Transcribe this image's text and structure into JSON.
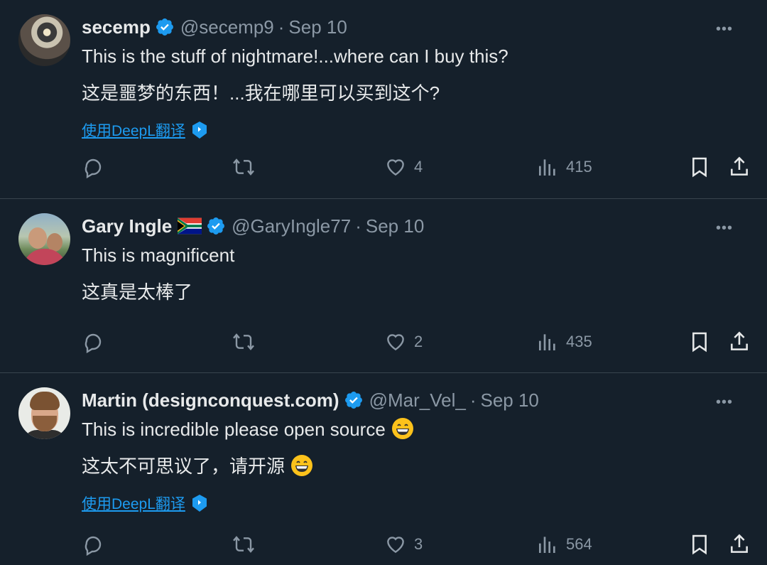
{
  "tweets": [
    {
      "author": "secemp",
      "handle": "@secemp9",
      "dot": "·",
      "date": "Sep 10",
      "text_en": "This is the stuff of nightmare!...where can I buy this?",
      "text_zh": "这是噩梦的东西！...我在哪里可以买到这个?",
      "translate_label": "使用DeepL翻译",
      "replies": "",
      "retweets": "",
      "likes": "4",
      "views": "415"
    },
    {
      "author": "Gary Ingle",
      "handle": "@GaryIngle77",
      "dot": "·",
      "date": "Sep 10",
      "text_en": "This is magnificent",
      "text_zh": "这真是太棒了",
      "replies": "",
      "retweets": "",
      "likes": "2",
      "views": "435"
    },
    {
      "author": "Martin (designconquest.com)",
      "handle": "@Mar_Vel_",
      "dot": "·",
      "date": "Sep 10",
      "text_en": "This is incredible please open source",
      "text_zh": "这太不可思议了，请开源",
      "translate_label": "使用DeepL翻译",
      "replies": "",
      "retweets": "",
      "likes": "3",
      "views": "564"
    }
  ],
  "more_label": "•••",
  "icons": {
    "verified": "verified-badge-icon",
    "flag": "south-africa-flag-icon",
    "reply": "reply-icon",
    "retweet": "retweet-icon",
    "like": "heart-icon",
    "views": "views-icon",
    "bookmark": "bookmark-icon",
    "share": "share-icon",
    "emoji": "grinning-face-emoji"
  },
  "colors": {
    "background": "#15202b",
    "text": "#e7e9ea",
    "secondary": "#8b98a5",
    "link": "#1d9bf0",
    "divider": "#38444d"
  }
}
